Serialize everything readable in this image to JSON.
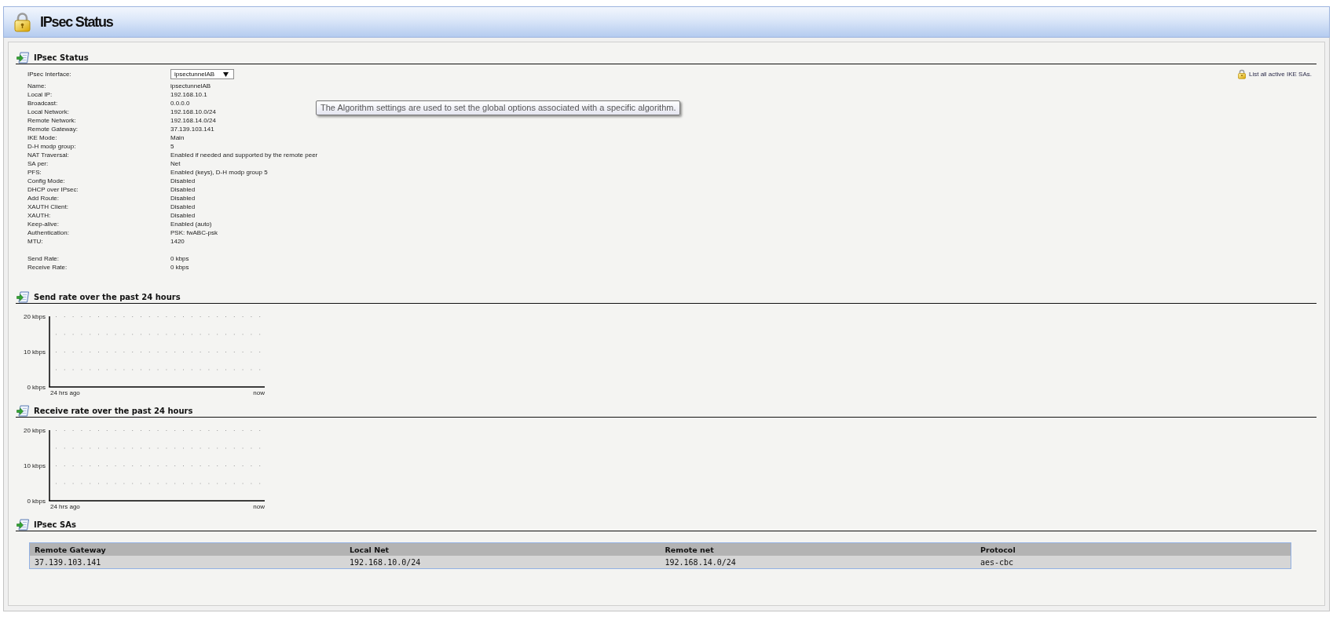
{
  "page_header": {
    "title": "IPsec Status"
  },
  "status": {
    "title": "IPsec Status",
    "interface": {
      "label": "IPsec Interface:",
      "value": "ipsectunnelAB"
    },
    "fields": [
      {
        "label": "Name:",
        "value": "ipsectunnelAB"
      },
      {
        "label": "Local IP:",
        "value": "192.168.10.1"
      },
      {
        "label": "Broadcast:",
        "value": "0.0.0.0"
      },
      {
        "label": "Local Network:",
        "value": "192.168.10.0/24"
      },
      {
        "label": "Remote Network:",
        "value": "192.168.14.0/24"
      },
      {
        "label": "Remote Gateway:",
        "value": "37.139.103.141"
      },
      {
        "label": "IKE Mode:",
        "value": "Main"
      },
      {
        "label": "D-H modp group:",
        "value": "5"
      },
      {
        "label": "NAT Traversal:",
        "value": "Enabled if needed and supported by the remote peer"
      },
      {
        "label": "SA per:",
        "value": "Net"
      },
      {
        "label": "PFS:",
        "value": "Enabled (keys), D-H modp group 5"
      },
      {
        "label": "Config Mode:",
        "value": "Disabled"
      },
      {
        "label": "DHCP over IPsec:",
        "value": "Disabled"
      },
      {
        "label": "Add Route:",
        "value": "Disabled"
      },
      {
        "label": "XAUTH Client:",
        "value": "Disabled"
      },
      {
        "label": "XAUTH:",
        "value": "Disabled"
      },
      {
        "label": "Keep-alive:",
        "value": "Enabled (auto)"
      },
      {
        "label": "Authentication:",
        "value": "PSK: fwABC-psk"
      },
      {
        "label": "MTU:",
        "value": "1420"
      }
    ],
    "rates": [
      {
        "label": "Send Rate:",
        "value": "0 kbps"
      },
      {
        "label": "Receive Rate:",
        "value": "0 kbps"
      }
    ],
    "ike_link": "List all active IKE SAs."
  },
  "tooltip": "The Algorithm settings are used to set the global options associated with a specific algorithm.",
  "rate_charts": [
    {
      "title": "Send rate over the past 24 hours",
      "chart_data": {
        "type": "line",
        "categories": [
          "24 hrs ago",
          "now"
        ],
        "ylim": [
          0,
          20
        ],
        "yticks": [
          {
            "value": 0,
            "label": "0 kbps"
          },
          {
            "value": 10,
            "label": "10 kbps"
          },
          {
            "value": 20,
            "label": "20 kbps"
          }
        ],
        "ref_lines": [
          {
            "axis": "y",
            "value": 5
          },
          {
            "axis": "y",
            "value": 10
          },
          {
            "axis": "y",
            "value": 15
          },
          {
            "axis": "y",
            "value": 20
          }
        ]
      }
    },
    {
      "title": "Receive rate over the past 24 hours",
      "chart_data": {
        "type": "line",
        "categories": [
          "24 hrs ago",
          "now"
        ],
        "ylim": [
          0,
          20
        ],
        "yticks": [
          {
            "value": 0,
            "label": "0 kbps"
          },
          {
            "value": 10,
            "label": "10 kbps"
          },
          {
            "value": 20,
            "label": "20 kbps"
          }
        ],
        "ref_lines": [
          {
            "axis": "y",
            "value": 5
          },
          {
            "axis": "y",
            "value": 10
          },
          {
            "axis": "y",
            "value": 15
          },
          {
            "axis": "y",
            "value": 20
          }
        ]
      }
    }
  ],
  "sa_table": {
    "title": "IPsec SAs",
    "columns": [
      "Remote Gateway",
      "Local Net",
      "Remote net",
      "Protocol"
    ],
    "rows": [
      [
        "37.139.103.141",
        "192.168.10.0/24",
        "192.168.14.0/24",
        "aes-cbc"
      ]
    ]
  }
}
